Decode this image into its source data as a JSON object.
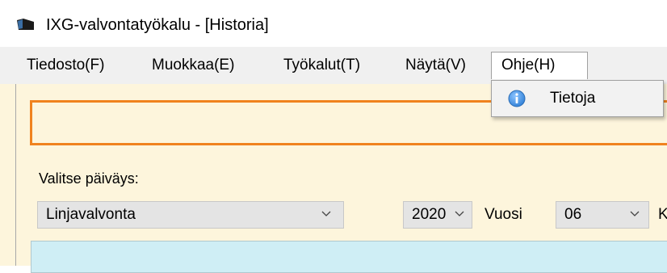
{
  "window": {
    "title": "IXG-valvontatyökalu - [Historia]"
  },
  "menu": {
    "items": [
      {
        "label": "Tiedosto(F)"
      },
      {
        "label": "Muokkaa(E)"
      },
      {
        "label": "Työkalut(T)"
      },
      {
        "label": "Näytä(V)"
      },
      {
        "label": "Ohje(H)"
      }
    ],
    "open_dropdown": {
      "items": [
        {
          "label": "Tietoja",
          "icon": "info-icon"
        }
      ]
    }
  },
  "form": {
    "date_label": "Valitse päiväys:",
    "mode_select": {
      "value": "Linjavalvonta"
    },
    "year_select": {
      "value": "2020"
    },
    "year_label": "Vuosi",
    "month_select": {
      "value": "06"
    },
    "month_label_partial": "K"
  },
  "colors": {
    "accent_orange": "#f0821e",
    "panel_blue": "#cfeef5",
    "window_bg": "#fdf5dc",
    "info_icon_blue": "#2f7fd6"
  }
}
